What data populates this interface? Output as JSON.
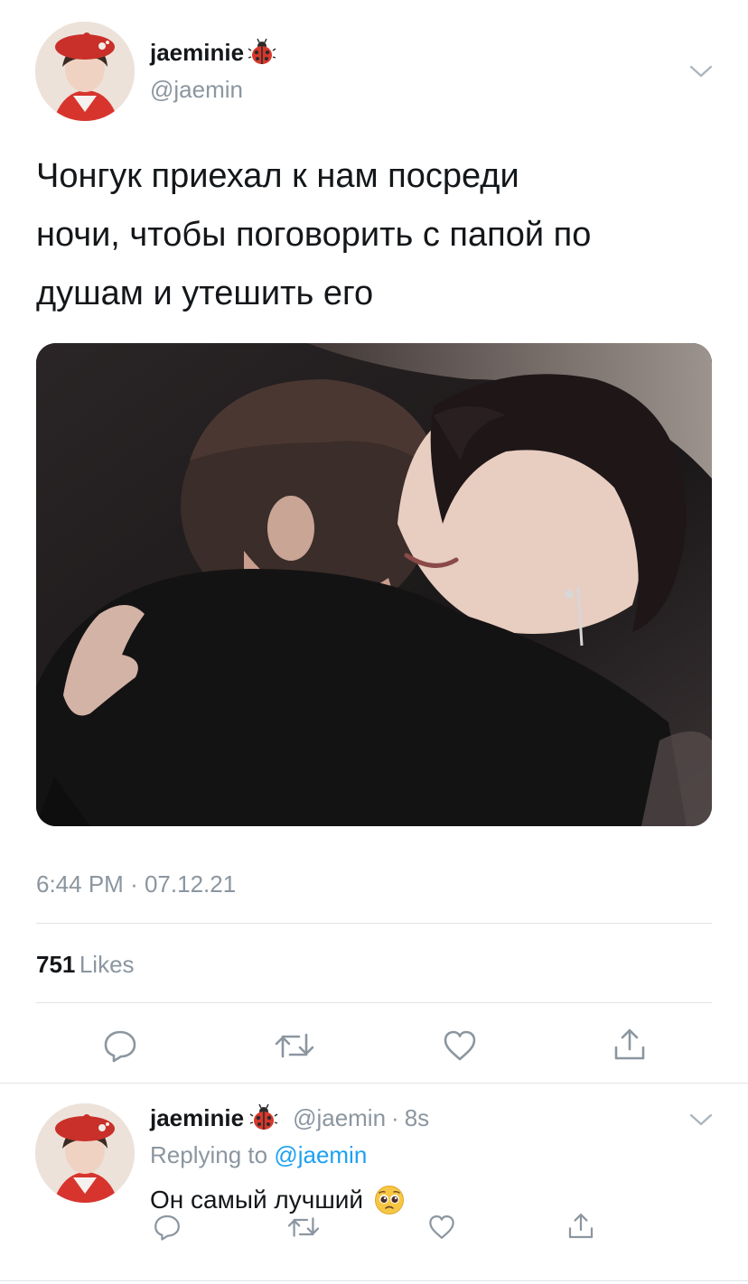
{
  "tweet": {
    "author_name": "jaeminie",
    "author_handle": "@jaemin",
    "text_lines": [
      "Чонгук приехал к нам посреди",
      "ночи, чтобы поговорить с папой по",
      "душам и утешить его"
    ],
    "time": "6:44 PM",
    "date": "07.12.21",
    "separator": "·",
    "likes_count": "751",
    "likes_label": "Likes"
  },
  "reply": {
    "author_name": "jaeminie",
    "author_handle": "@jaemin",
    "age": "8s",
    "separator": "·",
    "replying_prefix": "Replying to",
    "replying_handle": "@jaemin",
    "text": "Он самый лучший"
  },
  "icons": {
    "name_badge": "ladybug-icon",
    "menu": "chevron-down-icon",
    "reply": "reply-icon",
    "retweet": "retweet-icon",
    "like": "heart-icon",
    "share": "share-icon",
    "emoji": "pleading-face-icon"
  },
  "colors": {
    "link": "#1da1f2",
    "secondary_text": "#8b96a0",
    "primary_text": "#14171a",
    "divider": "#dfe3e7"
  }
}
